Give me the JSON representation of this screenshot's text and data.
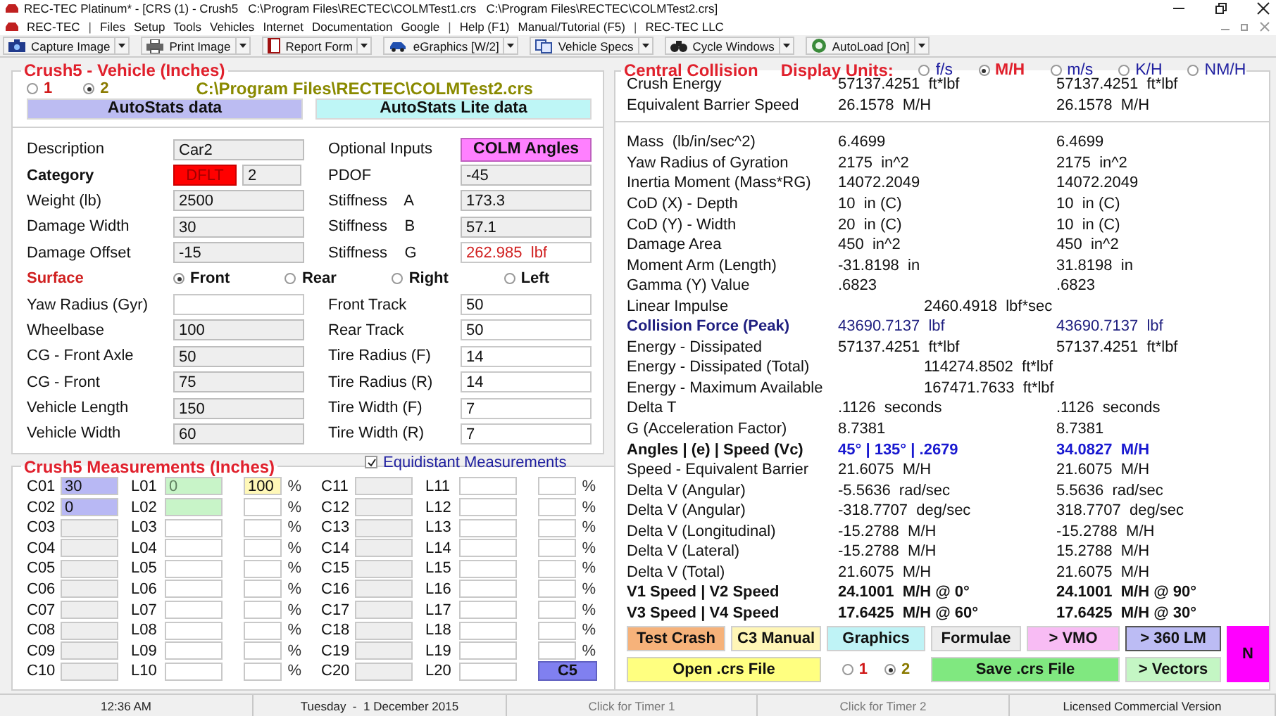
{
  "window": {
    "title": "REC-TEC Platinum* - [CRS (1) - Crush5   C:\\Program Files\\RECTEC\\COLMTest1.crs   C:\\Program Files\\RECTEC\\COLMTest2.crs]"
  },
  "menu": [
    {
      "kind": "item",
      "label": "REC-TEC"
    },
    {
      "kind": "separator",
      "label": "|"
    },
    {
      "kind": "item",
      "label": "Files"
    },
    {
      "kind": "item",
      "label": "Setup"
    },
    {
      "kind": "item",
      "label": "Tools"
    },
    {
      "kind": "item",
      "label": "Vehicles"
    },
    {
      "kind": "item",
      "label": "Internet"
    },
    {
      "kind": "item",
      "label": "Documentation"
    },
    {
      "kind": "item",
      "label": "Google"
    },
    {
      "kind": "separator",
      "label": "|"
    },
    {
      "kind": "item",
      "label": "Help (F1)"
    },
    {
      "kind": "item",
      "label": "Manual/Tutorial (F5)"
    },
    {
      "kind": "separator",
      "label": "|"
    },
    {
      "kind": "item",
      "label": "REC-TEC LLC"
    }
  ],
  "toolbar": [
    {
      "label": "Capture Image"
    },
    {
      "label": "Print Image"
    },
    {
      "label": "Report Form"
    },
    {
      "label": "eGraphics [W/2]"
    },
    {
      "label": "Vehicle Specs"
    },
    {
      "label": "Cycle Windows"
    },
    {
      "label": "AutoLoad [On]"
    }
  ],
  "vehicle": {
    "title": "Crush5 - Vehicle (Inches)",
    "vehicles": [
      {
        "label": "1",
        "selected": false,
        "color": "#d01818"
      },
      {
        "label": "2",
        "selected": true,
        "color": "#8a7a00"
      }
    ],
    "file_path": "C:\\Program Files\\RECTEC\\COLMTest2.crs",
    "data_buttons": [
      {
        "label": "AutoStats data",
        "color": "#bcbcf2"
      },
      {
        "label": "AutoStats Lite data",
        "color": "#bef6f6"
      }
    ],
    "upper_rows": [
      {
        "left": {
          "kind": "field",
          "label": "Description",
          "value": "Car2",
          "editable": false
        },
        "right": {
          "kind": "button",
          "label": "Optional Inputs",
          "button": "COLM Angles"
        }
      },
      {
        "left": {
          "kind": "category",
          "label": "Category",
          "badge": "DFLT",
          "value": "2",
          "editable": false
        },
        "right": {
          "kind": "field",
          "label": "PDOF",
          "value": "-45",
          "editable": false
        }
      },
      {
        "left": {
          "kind": "field",
          "label": "Weight (lb)",
          "value": "2500",
          "editable": false
        },
        "right": {
          "kind": "field",
          "label": "Stiffness    A",
          "value": "173.3",
          "editable": false
        }
      },
      {
        "left": {
          "kind": "field",
          "label": "Damage Width",
          "value": "30",
          "editable": false
        },
        "right": {
          "kind": "field",
          "label": "Stiffness    B",
          "value": "57.1",
          "editable": false
        }
      },
      {
        "left": {
          "kind": "field",
          "label": "Damage Offset",
          "value": "-15",
          "editable": false
        },
        "right": {
          "kind": "field",
          "label": "Stiffness    G",
          "value": "262.985  lbf",
          "editable": true,
          "warning": true
        }
      }
    ],
    "surface": {
      "label": "Surface",
      "options": [
        {
          "label": "Front",
          "selected": true
        },
        {
          "label": "Rear",
          "selected": false
        },
        {
          "label": "Right",
          "selected": false
        },
        {
          "label": "Left",
          "selected": false
        }
      ]
    },
    "lower_rows": [
      {
        "left": {
          "kind": "field",
          "label": "Yaw Radius (Gyr)",
          "editable": true
        },
        "right": {
          "kind": "field",
          "label": "Front Track",
          "value": "50",
          "editable": true
        }
      },
      {
        "left": {
          "kind": "field",
          "label": "Wheelbase",
          "value": "100",
          "editable": false
        },
        "right": {
          "kind": "field",
          "label": "Rear Track",
          "value": "50",
          "editable": true
        }
      },
      {
        "left": {
          "kind": "field",
          "label": "CG - Front Axle",
          "value": "50",
          "editable": false
        },
        "right": {
          "kind": "field",
          "label": "Tire Radius (F)",
          "value": "14",
          "editable": true
        }
      },
      {
        "left": {
          "kind": "field",
          "label": "CG - Front",
          "value": "75",
          "editable": false
        },
        "right": {
          "kind": "field",
          "label": "Tire Radius (R)",
          "value": "14",
          "editable": true
        }
      },
      {
        "left": {
          "kind": "field",
          "label": "Vehicle Length",
          "value": "150",
          "editable": false
        },
        "right": {
          "kind": "field",
          "label": "Tire Width (F)",
          "value": "7",
          "editable": true
        }
      },
      {
        "left": {
          "kind": "field",
          "label": "Vehicle Width",
          "value": "60",
          "editable": false
        },
        "right": {
          "kind": "field",
          "label": "Tire Width (R)",
          "value": "7",
          "editable": true
        }
      }
    ]
  },
  "measurements": {
    "title": "Crush5 Measurements (Inches)",
    "equidistant": {
      "label": "Equidistant Measurements",
      "checked": true
    },
    "button": "C5",
    "rows": [
      {
        "c": {
          "label": "C01",
          "value": "30",
          "color": "#b8b8f4"
        },
        "l": {
          "label": "L01",
          "value": "0",
          "color": "#c8f4c8"
        },
        "pct": {
          "value": "100",
          "color": "#fff8b8"
        },
        "unit": "%",
        "c2": {
          "label": "C11"
        },
        "l2": {
          "label": "L11"
        },
        "pct2": {},
        "unit2": "%"
      },
      {
        "c": {
          "label": "C02",
          "value": "0",
          "color": "#b8b8f4"
        },
        "l": {
          "label": "L02",
          "color": "#c8f4c8"
        },
        "pct": {},
        "unit": "%",
        "c2": {
          "label": "C12"
        },
        "l2": {
          "label": "L12"
        },
        "pct2": {},
        "unit2": "%"
      },
      {
        "c": {
          "label": "C03"
        },
        "l": {
          "label": "L03"
        },
        "pct": {},
        "unit": "%",
        "c2": {
          "label": "C13"
        },
        "l2": {
          "label": "L13"
        },
        "pct2": {},
        "unit2": "%"
      },
      {
        "c": {
          "label": "C04"
        },
        "l": {
          "label": "L04"
        },
        "pct": {},
        "unit": "%",
        "c2": {
          "label": "C14"
        },
        "l2": {
          "label": "L14"
        },
        "pct2": {},
        "unit2": "%"
      },
      {
        "c": {
          "label": "C05"
        },
        "l": {
          "label": "L05"
        },
        "pct": {},
        "unit": "%",
        "c2": {
          "label": "C15"
        },
        "l2": {
          "label": "L15"
        },
        "pct2": {},
        "unit2": "%"
      },
      {
        "c": {
          "label": "C06"
        },
        "l": {
          "label": "L06"
        },
        "pct": {},
        "unit": "%",
        "c2": {
          "label": "C16"
        },
        "l2": {
          "label": "L16"
        },
        "pct2": {},
        "unit2": "%"
      },
      {
        "c": {
          "label": "C07"
        },
        "l": {
          "label": "L07"
        },
        "pct": {},
        "unit": "%",
        "c2": {
          "label": "C17"
        },
        "l2": {
          "label": "L17"
        },
        "pct2": {},
        "unit2": "%"
      },
      {
        "c": {
          "label": "C08"
        },
        "l": {
          "label": "L08"
        },
        "pct": {},
        "unit": "%",
        "c2": {
          "label": "C18"
        },
        "l2": {
          "label": "L18"
        },
        "pct2": {},
        "unit2": "%"
      },
      {
        "c": {
          "label": "C09"
        },
        "l": {
          "label": "L09"
        },
        "pct": {},
        "unit": "%",
        "c2": {
          "label": "C19"
        },
        "l2": {
          "label": "L19"
        },
        "pct2": {},
        "unit2": "%"
      },
      {
        "c": {
          "label": "C10"
        },
        "l": {
          "label": "L10"
        },
        "pct": {},
        "unit": "%",
        "c2": {
          "label": "C20"
        },
        "l2": {
          "label": "L20"
        }
      }
    ]
  },
  "collision": {
    "title": "Central Collision",
    "units_label": "Display Units:",
    "units": [
      {
        "label": "f/s",
        "selected": false
      },
      {
        "label": "M/H",
        "selected": true
      },
      {
        "label": "m/s",
        "selected": false
      },
      {
        "label": "K/H",
        "selected": false
      },
      {
        "label": "NM/H",
        "selected": false
      }
    ],
    "summary": [
      {
        "kind": "pair",
        "label": "Crush Energy",
        "v1": "57137.4251  ft*lbf",
        "v2": "57137.4251  ft*lbf"
      },
      {
        "kind": "pair",
        "label": "Equivalent Barrier Speed",
        "v1": "26.1578  M/H",
        "v2": "26.1578  M/H"
      }
    ],
    "rows": [
      {
        "kind": "pair",
        "label": "Mass  (lb/in/sec^2)",
        "v1": "6.4699",
        "v2": "6.4699"
      },
      {
        "kind": "pair",
        "label": "Yaw Radius of Gyration",
        "v1": "2175  in^2",
        "v2": "2175  in^2"
      },
      {
        "kind": "pair",
        "label": "Inertia Moment (Mass*RG)",
        "v1": "14072.2049",
        "v2": "14072.2049"
      },
      {
        "kind": "pair",
        "label": "CoD (X) - Depth",
        "v1": "10  in (C)",
        "v2": "10  in (C)"
      },
      {
        "kind": "pair",
        "label": "CoD (Y) - Width",
        "v1": "20  in (C)",
        "v2": "10  in (C)"
      },
      {
        "kind": "pair",
        "label": "Damage Area",
        "v1": "450  in^2",
        "v2": "450  in^2"
      },
      {
        "kind": "pair",
        "label": "Moment Arm (Length)",
        "v1": "-31.8198  in",
        "v2": "31.8198  in"
      },
      {
        "kind": "pair",
        "label": "Gamma (Y) Value",
        "v1": ".6823",
        "v2": ".6823"
      },
      {
        "kind": "shared",
        "label": "Linear Impulse",
        "value": "2460.4918  lbf*sec"
      },
      {
        "kind": "force",
        "label": "Collision Force (Peak)",
        "v1": "43690.7137  lbf",
        "v2": "43690.7137  lbf"
      },
      {
        "kind": "pair",
        "label": "Energy - Dissipated",
        "v1": "57137.4251  ft*lbf",
        "v2": "57137.4251  ft*lbf"
      },
      {
        "kind": "shared",
        "label": "Energy - Dissipated (Total)",
        "value": "114274.8502  ft*lbf"
      },
      {
        "kind": "shared",
        "label": "Energy - Maximum Available",
        "value": "167471.7633  ft*lbf"
      },
      {
        "kind": "pair",
        "label": "Delta T",
        "v1": ".1126  seconds",
        "v2": ".1126  seconds"
      },
      {
        "kind": "pair",
        "label": "G (Acceleration Factor)",
        "v1": "8.7381",
        "v2": "8.7381"
      },
      {
        "kind": "angles",
        "label": "Angles | (e) | Speed (Vc)",
        "v1": "45° | 135° | .2679",
        "v2": "34.0827  M/H"
      },
      {
        "kind": "pair",
        "label": "Speed - Equivalent Barrier",
        "v1": "21.6075  M/H",
        "v2": "21.6075  M/H"
      },
      {
        "kind": "pair",
        "label": "Delta V (Angular)",
        "v1": "-5.5636  rad/sec",
        "v2": "5.5636  rad/sec"
      },
      {
        "kind": "pair",
        "label": "Delta V (Angular)",
        "v1": "-318.7707  deg/sec",
        "v2": "318.7707  deg/sec"
      },
      {
        "kind": "pair",
        "label": "Delta V (Longitudinal)",
        "v1": "-15.2788  M/H",
        "v2": "-15.2788  M/H"
      },
      {
        "kind": "pair",
        "label": "Delta V (Lateral)",
        "v1": "-15.2788  M/H",
        "v2": "15.2788  M/H"
      },
      {
        "kind": "pair",
        "label": "Delta V (Total)",
        "v1": "21.6075  M/H",
        "v2": "21.6075  M/H"
      },
      {
        "kind": "bold",
        "label": "V1 Speed | V2 Speed",
        "v1": "24.1001  M/H @ 0°",
        "v2": "24.1001  M/H @ 90°"
      },
      {
        "kind": "bold",
        "label": "V3 Speed | V4 Speed",
        "v1": "17.6425  M/H @ 60°",
        "v2": "17.6425  M/H @ 30°"
      }
    ]
  },
  "actions": {
    "top": [
      {
        "label": "Test Crash",
        "color": "#f6b27a"
      },
      {
        "label": "C3 Manual",
        "color": "#fff6b6"
      },
      {
        "label": "Graphics",
        "color": "#bff3f6"
      },
      {
        "label": "Formulae",
        "color": "#ececec"
      },
      {
        "label": "> VMO",
        "color": "#f8bcf4"
      },
      {
        "label": "> 360 LM",
        "color": "#bcbcf4"
      }
    ],
    "side": {
      "label": "N",
      "color": "#ff00ff"
    },
    "open": {
      "label": "Open .crs File",
      "color": "#ffff80"
    },
    "vehicles": [
      {
        "label": "1",
        "selected": false,
        "color": "#d01818"
      },
      {
        "label": "2",
        "selected": true,
        "color": "#8a7a00"
      }
    ],
    "save": {
      "label": "Save .crs File",
      "color": "#80e880"
    },
    "vectors": {
      "label": "> Vectors",
      "color": "#c4f6c4"
    }
  },
  "status_bar": [
    {
      "text": "12:36 AM",
      "dim": false
    },
    {
      "text": "Tuesday  -  1 December 2015",
      "dim": false
    },
    {
      "text": "Click for Timer 1",
      "dim": true
    },
    {
      "text": "Click for Timer 2",
      "dim": true
    },
    {
      "text": "Licensed Commercial Version",
      "dim": false
    }
  ]
}
